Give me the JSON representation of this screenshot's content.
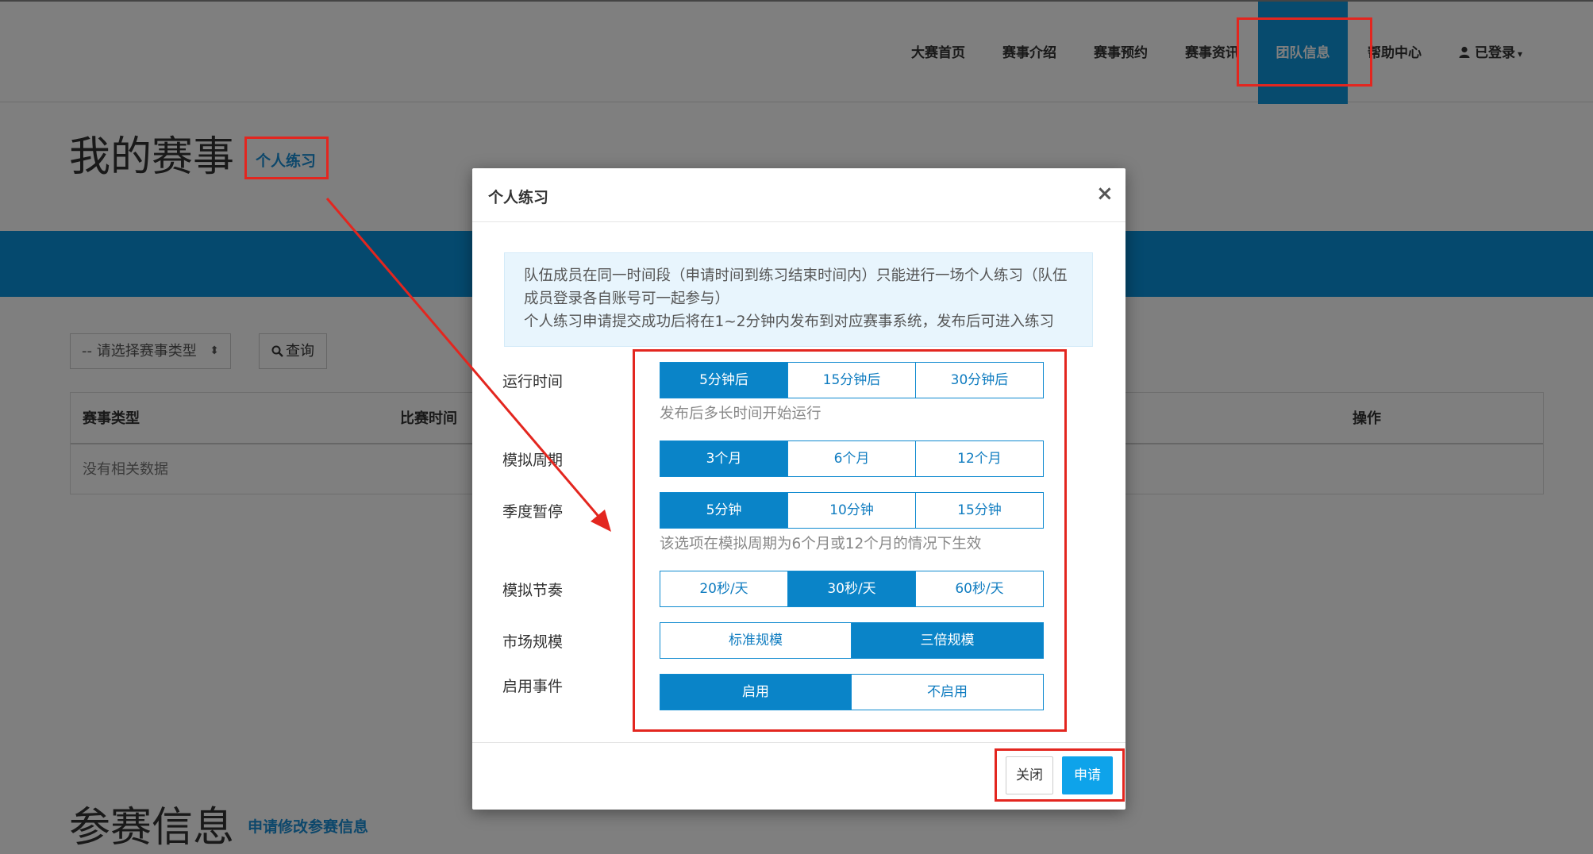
{
  "nav": {
    "items": [
      "大赛首页",
      "赛事介绍",
      "赛事预约",
      "赛事资讯",
      "团队信息",
      "帮助中心"
    ],
    "user_icon": "user-icon",
    "user_label": "已登录",
    "user_caret": "▾"
  },
  "page": {
    "title": "我的赛事",
    "practice_link": "个人练习",
    "filter_select": "-- 请选择赛事类型",
    "select_arrows": "⬍",
    "search_icon": "search-icon",
    "search_label": "查询",
    "table_headers": [
      "赛事类型",
      "比赛时间",
      "操作"
    ],
    "table_empty": "没有相关数据",
    "section2_title": "参赛信息",
    "section2_link": "申请修改参赛信息"
  },
  "modal": {
    "title": "个人练习",
    "close_glyph": "×",
    "notice_line1": "队伍成员在同一时间段（申请时间到练习结束时间内）只能进行一场个人练习（队伍成员登录各自账号可一起参与）",
    "notice_line2": "个人练习申请提交成功后将在1~2分钟内发布到对应赛事系统，发布后可进入练习",
    "fields": {
      "run_time": {
        "label": "运行时间",
        "options": [
          "5分钟后",
          "15分钟后",
          "30分钟后"
        ],
        "selected": "5分钟后",
        "help": "发布后多长时间开始运行"
      },
      "sim_period": {
        "label": "模拟周期",
        "options": [
          "3个月",
          "6个月",
          "12个月"
        ],
        "selected": "3个月"
      },
      "season_pause": {
        "label": "季度暂停",
        "options": [
          "5分钟",
          "10分钟",
          "15分钟"
        ],
        "selected": "5分钟",
        "help": "该选项在模拟周期为6个月或12个月的情况下生效"
      },
      "sim_pace": {
        "label": "模拟节奏",
        "options": [
          "20秒/天",
          "30秒/天",
          "60秒/天"
        ],
        "selected": "30秒/天"
      },
      "market_scale": {
        "label": "市场规模",
        "options": [
          "标准规模",
          "三倍规模"
        ],
        "selected": "三倍规模"
      },
      "enable_events": {
        "label": "启用事件",
        "options": [
          "启用",
          "不启用"
        ],
        "selected": "启用"
      }
    },
    "close_button": "关闭",
    "apply_button": "申请"
  },
  "colors": {
    "nav_active": "#0f97dc",
    "band": "#0a92dc",
    "option_active": "#0a84c8",
    "apply": "#0ea3ea",
    "annotation": "#e3261f"
  }
}
